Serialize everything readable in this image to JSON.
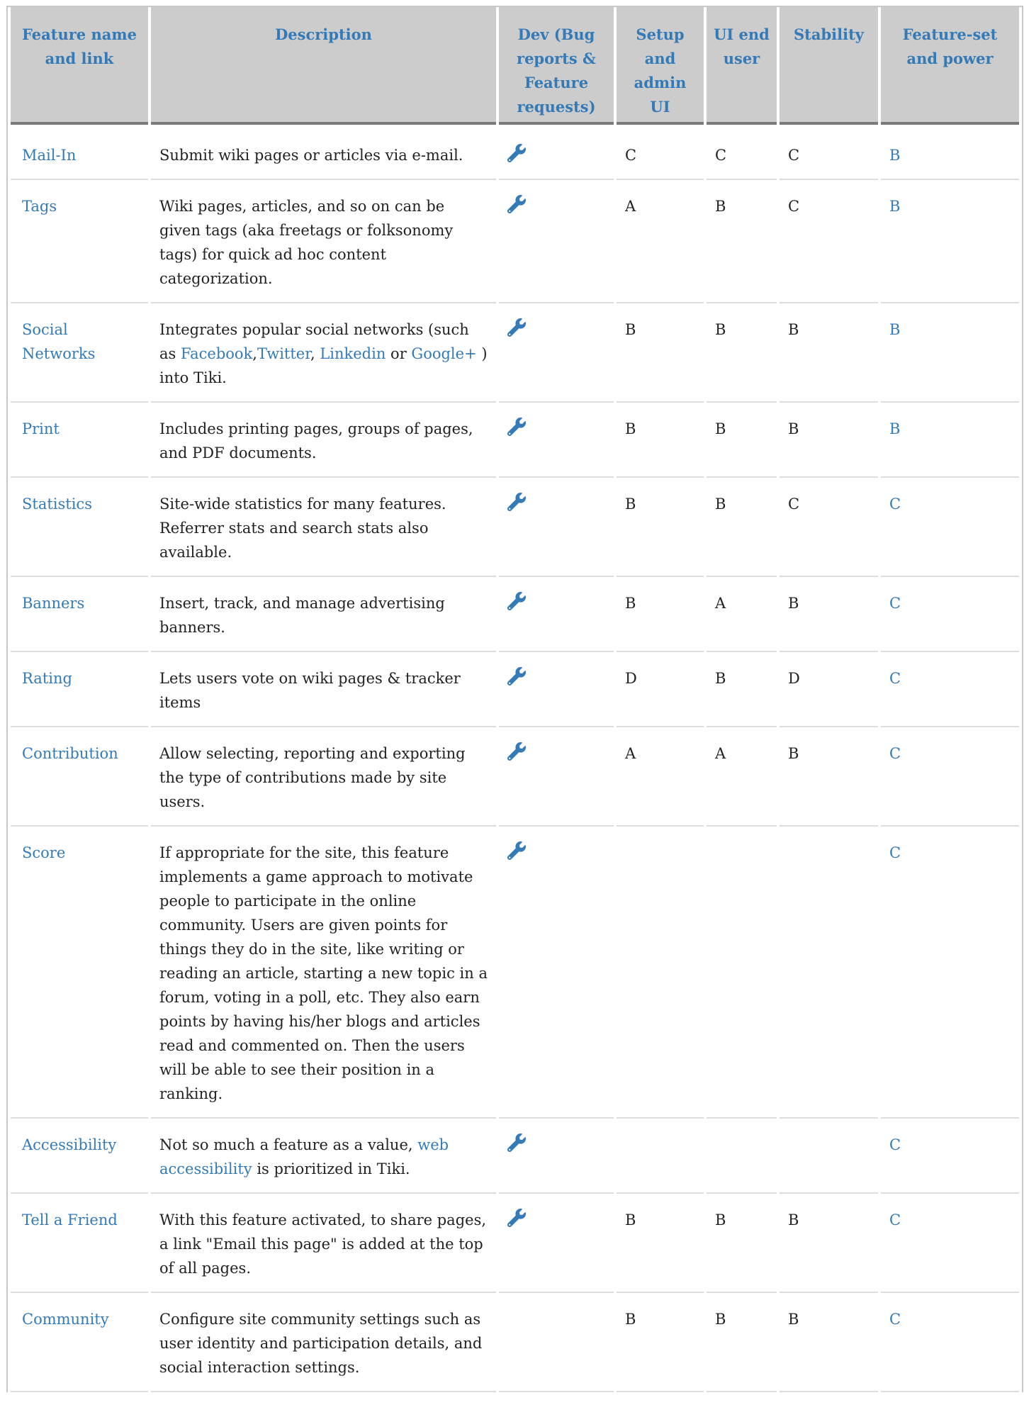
{
  "table": {
    "headers": [
      "Feature name and link",
      "Description",
      "Dev (Bug reports & Feature requests)",
      "Setup and admin UI",
      "UI end user",
      "Stability",
      "Feature-set and power"
    ],
    "rows": [
      {
        "name": "Mail-In",
        "desc": "Submit wiki pages or articles via e-mail.",
        "wrench": true,
        "setup": "C",
        "ui": "C",
        "stability": "C",
        "power": "B"
      },
      {
        "name": "Tags",
        "desc": "Wiki pages, articles, and so on can be given tags (aka freetags or folksonomy tags) for quick ad hoc content categorization.",
        "wrench": true,
        "setup": "A",
        "ui": "B",
        "stability": "C",
        "power": "B"
      },
      {
        "name": "Social Networks",
        "desc_parts": [
          "Integrates popular social networks (such as ",
          "Facebook",
          ",",
          "Twitter",
          ", ",
          "Linkedin",
          " or ",
          "Google+",
          " ) into Tiki."
        ],
        "wrench": true,
        "setup": "B",
        "ui": "B",
        "stability": "B",
        "power": "B"
      },
      {
        "name": "Print",
        "desc": "Includes printing pages, groups of pages, and PDF documents.",
        "wrench": true,
        "setup": "B",
        "ui": "B",
        "stability": "B",
        "power": "B"
      },
      {
        "name": "Statistics",
        "desc": "Site-wide statistics for many features. Referrer stats and search stats also available.",
        "wrench": true,
        "setup": "B",
        "ui": "B",
        "stability": "C",
        "power": "C"
      },
      {
        "name": "Banners",
        "desc": "Insert, track, and manage advertising banners.",
        "wrench": true,
        "setup": "B",
        "ui": "A",
        "stability": "B",
        "power": "C"
      },
      {
        "name": "Rating",
        "desc": "Lets users vote on wiki pages & tracker items",
        "wrench": true,
        "setup": "D",
        "ui": "B",
        "stability": "D",
        "power": "C"
      },
      {
        "name": "Contribution",
        "desc": "Allow selecting, reporting and exporting the type of contributions made by site users.",
        "wrench": true,
        "setup": "A",
        "ui": "A",
        "stability": "B",
        "power": "C"
      },
      {
        "name": "Score",
        "desc": "If appropriate for the site, this feature implements a game approach to motivate people to participate in the online community. Users are given points for things they do in the site, like writing or reading an article, starting a new topic in a forum, voting in a poll, etc. They also earn points by having his/her blogs and articles read and commented on. Then the users will be able to see their position in a ranking.",
        "wrench": true,
        "setup": "",
        "ui": "",
        "stability": "",
        "power": "C"
      },
      {
        "name": "Accessibility",
        "desc_parts": [
          "Not so much a feature as a value, ",
          "web accessibility",
          " is prioritized in Tiki."
        ],
        "wrench": true,
        "setup": "",
        "ui": "",
        "stability": "",
        "power": "C"
      },
      {
        "name": "Tell a Friend",
        "desc": "With this feature activated, to share pages, a link \"Email this page\" is added at the top of all pages.",
        "wrench": true,
        "setup": "B",
        "ui": "B",
        "stability": "B",
        "power": "C"
      },
      {
        "name": "Community",
        "desc": "Configure site community settings such as user identity and participation details, and social interaction settings.",
        "wrench": false,
        "setup": "B",
        "ui": "B",
        "stability": "B",
        "power": "C"
      }
    ]
  },
  "colors": {
    "link": "#337ab7",
    "header_bg": "#cccccc",
    "text": "#222222"
  },
  "icons": {
    "dev": "wrench-icon"
  }
}
